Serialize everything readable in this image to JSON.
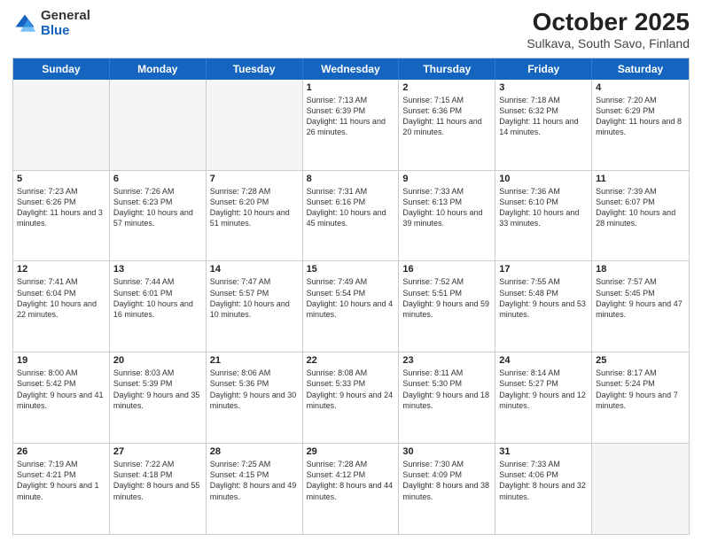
{
  "header": {
    "logo": {
      "line1": "General",
      "line2": "Blue"
    },
    "title": "October 2025",
    "subtitle": "Sulkava, South Savo, Finland"
  },
  "weekdays": [
    "Sunday",
    "Monday",
    "Tuesday",
    "Wednesday",
    "Thursday",
    "Friday",
    "Saturday"
  ],
  "weeks": [
    [
      {
        "day": "",
        "sunrise": "",
        "sunset": "",
        "daylight": "",
        "empty": true
      },
      {
        "day": "",
        "sunrise": "",
        "sunset": "",
        "daylight": "",
        "empty": true
      },
      {
        "day": "",
        "sunrise": "",
        "sunset": "",
        "daylight": "",
        "empty": true
      },
      {
        "day": "1",
        "sunrise": "Sunrise: 7:13 AM",
        "sunset": "Sunset: 6:39 PM",
        "daylight": "Daylight: 11 hours and 26 minutes.",
        "empty": false
      },
      {
        "day": "2",
        "sunrise": "Sunrise: 7:15 AM",
        "sunset": "Sunset: 6:36 PM",
        "daylight": "Daylight: 11 hours and 20 minutes.",
        "empty": false
      },
      {
        "day": "3",
        "sunrise": "Sunrise: 7:18 AM",
        "sunset": "Sunset: 6:32 PM",
        "daylight": "Daylight: 11 hours and 14 minutes.",
        "empty": false
      },
      {
        "day": "4",
        "sunrise": "Sunrise: 7:20 AM",
        "sunset": "Sunset: 6:29 PM",
        "daylight": "Daylight: 11 hours and 8 minutes.",
        "empty": false
      }
    ],
    [
      {
        "day": "5",
        "sunrise": "Sunrise: 7:23 AM",
        "sunset": "Sunset: 6:26 PM",
        "daylight": "Daylight: 11 hours and 3 minutes.",
        "empty": false
      },
      {
        "day": "6",
        "sunrise": "Sunrise: 7:26 AM",
        "sunset": "Sunset: 6:23 PM",
        "daylight": "Daylight: 10 hours and 57 minutes.",
        "empty": false
      },
      {
        "day": "7",
        "sunrise": "Sunrise: 7:28 AM",
        "sunset": "Sunset: 6:20 PM",
        "daylight": "Daylight: 10 hours and 51 minutes.",
        "empty": false
      },
      {
        "day": "8",
        "sunrise": "Sunrise: 7:31 AM",
        "sunset": "Sunset: 6:16 PM",
        "daylight": "Daylight: 10 hours and 45 minutes.",
        "empty": false
      },
      {
        "day": "9",
        "sunrise": "Sunrise: 7:33 AM",
        "sunset": "Sunset: 6:13 PM",
        "daylight": "Daylight: 10 hours and 39 minutes.",
        "empty": false
      },
      {
        "day": "10",
        "sunrise": "Sunrise: 7:36 AM",
        "sunset": "Sunset: 6:10 PM",
        "daylight": "Daylight: 10 hours and 33 minutes.",
        "empty": false
      },
      {
        "day": "11",
        "sunrise": "Sunrise: 7:39 AM",
        "sunset": "Sunset: 6:07 PM",
        "daylight": "Daylight: 10 hours and 28 minutes.",
        "empty": false
      }
    ],
    [
      {
        "day": "12",
        "sunrise": "Sunrise: 7:41 AM",
        "sunset": "Sunset: 6:04 PM",
        "daylight": "Daylight: 10 hours and 22 minutes.",
        "empty": false
      },
      {
        "day": "13",
        "sunrise": "Sunrise: 7:44 AM",
        "sunset": "Sunset: 6:01 PM",
        "daylight": "Daylight: 10 hours and 16 minutes.",
        "empty": false
      },
      {
        "day": "14",
        "sunrise": "Sunrise: 7:47 AM",
        "sunset": "Sunset: 5:57 PM",
        "daylight": "Daylight: 10 hours and 10 minutes.",
        "empty": false
      },
      {
        "day": "15",
        "sunrise": "Sunrise: 7:49 AM",
        "sunset": "Sunset: 5:54 PM",
        "daylight": "Daylight: 10 hours and 4 minutes.",
        "empty": false
      },
      {
        "day": "16",
        "sunrise": "Sunrise: 7:52 AM",
        "sunset": "Sunset: 5:51 PM",
        "daylight": "Daylight: 9 hours and 59 minutes.",
        "empty": false
      },
      {
        "day": "17",
        "sunrise": "Sunrise: 7:55 AM",
        "sunset": "Sunset: 5:48 PM",
        "daylight": "Daylight: 9 hours and 53 minutes.",
        "empty": false
      },
      {
        "day": "18",
        "sunrise": "Sunrise: 7:57 AM",
        "sunset": "Sunset: 5:45 PM",
        "daylight": "Daylight: 9 hours and 47 minutes.",
        "empty": false
      }
    ],
    [
      {
        "day": "19",
        "sunrise": "Sunrise: 8:00 AM",
        "sunset": "Sunset: 5:42 PM",
        "daylight": "Daylight: 9 hours and 41 minutes.",
        "empty": false
      },
      {
        "day": "20",
        "sunrise": "Sunrise: 8:03 AM",
        "sunset": "Sunset: 5:39 PM",
        "daylight": "Daylight: 9 hours and 35 minutes.",
        "empty": false
      },
      {
        "day": "21",
        "sunrise": "Sunrise: 8:06 AM",
        "sunset": "Sunset: 5:36 PM",
        "daylight": "Daylight: 9 hours and 30 minutes.",
        "empty": false
      },
      {
        "day": "22",
        "sunrise": "Sunrise: 8:08 AM",
        "sunset": "Sunset: 5:33 PM",
        "daylight": "Daylight: 9 hours and 24 minutes.",
        "empty": false
      },
      {
        "day": "23",
        "sunrise": "Sunrise: 8:11 AM",
        "sunset": "Sunset: 5:30 PM",
        "daylight": "Daylight: 9 hours and 18 minutes.",
        "empty": false
      },
      {
        "day": "24",
        "sunrise": "Sunrise: 8:14 AM",
        "sunset": "Sunset: 5:27 PM",
        "daylight": "Daylight: 9 hours and 12 minutes.",
        "empty": false
      },
      {
        "day": "25",
        "sunrise": "Sunrise: 8:17 AM",
        "sunset": "Sunset: 5:24 PM",
        "daylight": "Daylight: 9 hours and 7 minutes.",
        "empty": false
      }
    ],
    [
      {
        "day": "26",
        "sunrise": "Sunrise: 7:19 AM",
        "sunset": "Sunset: 4:21 PM",
        "daylight": "Daylight: 9 hours and 1 minute.",
        "empty": false
      },
      {
        "day": "27",
        "sunrise": "Sunrise: 7:22 AM",
        "sunset": "Sunset: 4:18 PM",
        "daylight": "Daylight: 8 hours and 55 minutes.",
        "empty": false
      },
      {
        "day": "28",
        "sunrise": "Sunrise: 7:25 AM",
        "sunset": "Sunset: 4:15 PM",
        "daylight": "Daylight: 8 hours and 49 minutes.",
        "empty": false
      },
      {
        "day": "29",
        "sunrise": "Sunrise: 7:28 AM",
        "sunset": "Sunset: 4:12 PM",
        "daylight": "Daylight: 8 hours and 44 minutes.",
        "empty": false
      },
      {
        "day": "30",
        "sunrise": "Sunrise: 7:30 AM",
        "sunset": "Sunset: 4:09 PM",
        "daylight": "Daylight: 8 hours and 38 minutes.",
        "empty": false
      },
      {
        "day": "31",
        "sunrise": "Sunrise: 7:33 AM",
        "sunset": "Sunset: 4:06 PM",
        "daylight": "Daylight: 8 hours and 32 minutes.",
        "empty": false
      },
      {
        "day": "",
        "sunrise": "",
        "sunset": "",
        "daylight": "",
        "empty": true
      }
    ]
  ]
}
